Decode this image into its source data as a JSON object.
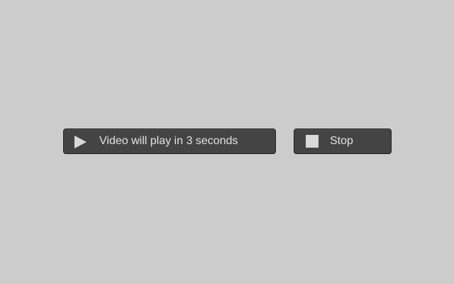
{
  "controls": {
    "play": {
      "icon": "play-icon",
      "label": "Video will play in 3 seconds"
    },
    "stop": {
      "icon": "stop-icon",
      "label": "Stop"
    }
  },
  "colors": {
    "background": "#cccccc",
    "button_bg": "#444444",
    "button_border": "#1f1f1f",
    "text": "#e2e2e2",
    "icon": "#d9d9d9"
  }
}
